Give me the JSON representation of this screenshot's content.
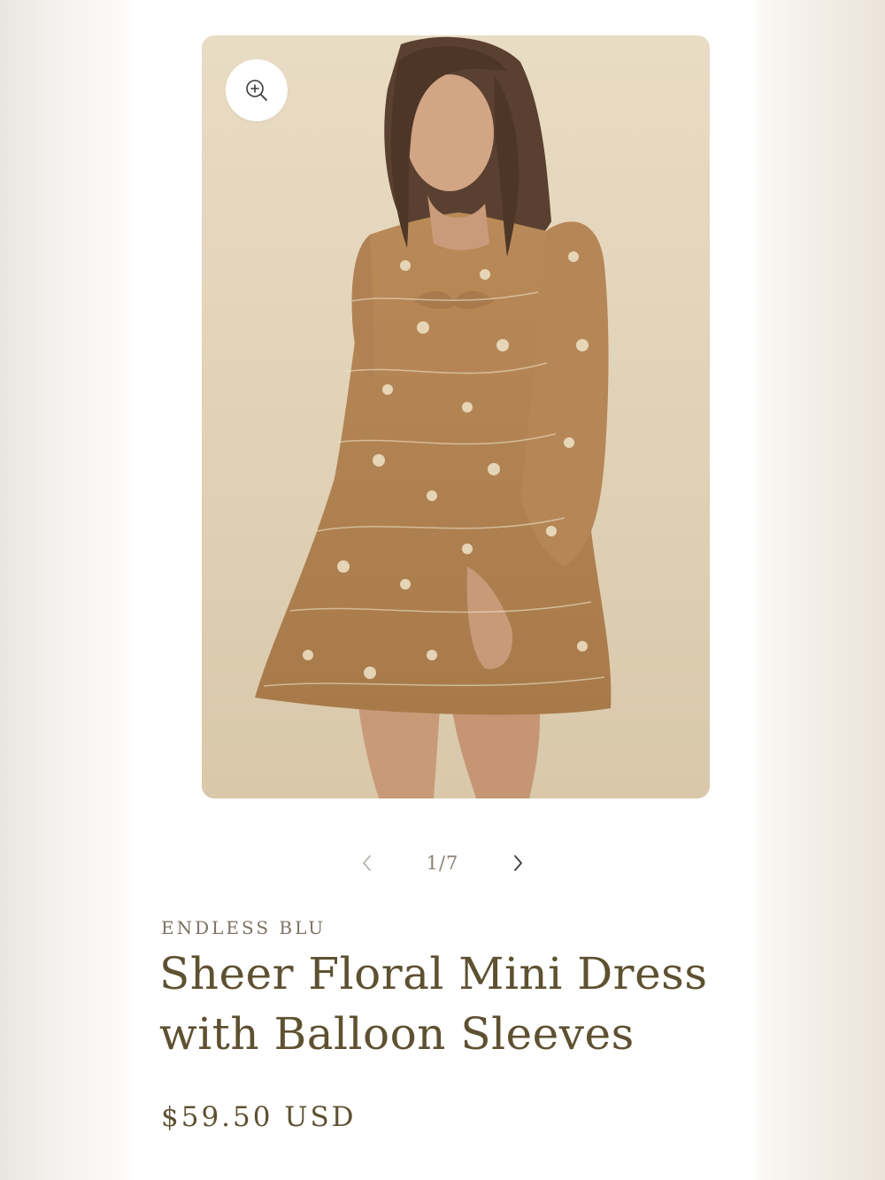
{
  "gallery": {
    "zoom_icon": "zoom-in-icon",
    "prev_icon": "chevron-left-icon",
    "next_icon": "chevron-right-icon",
    "current_index": 1,
    "total": 7,
    "counter": "1/7"
  },
  "product": {
    "vendor": "ENDLESS BLU",
    "title": "Sheer Floral Mini Dress with Balloon Sleeves",
    "price": "$59.50 USD"
  },
  "colors": {
    "title_text": "#5e5131",
    "vendor_text": "#7b7363",
    "dress": "#b88957",
    "photo_background": "#e4d6bc"
  }
}
